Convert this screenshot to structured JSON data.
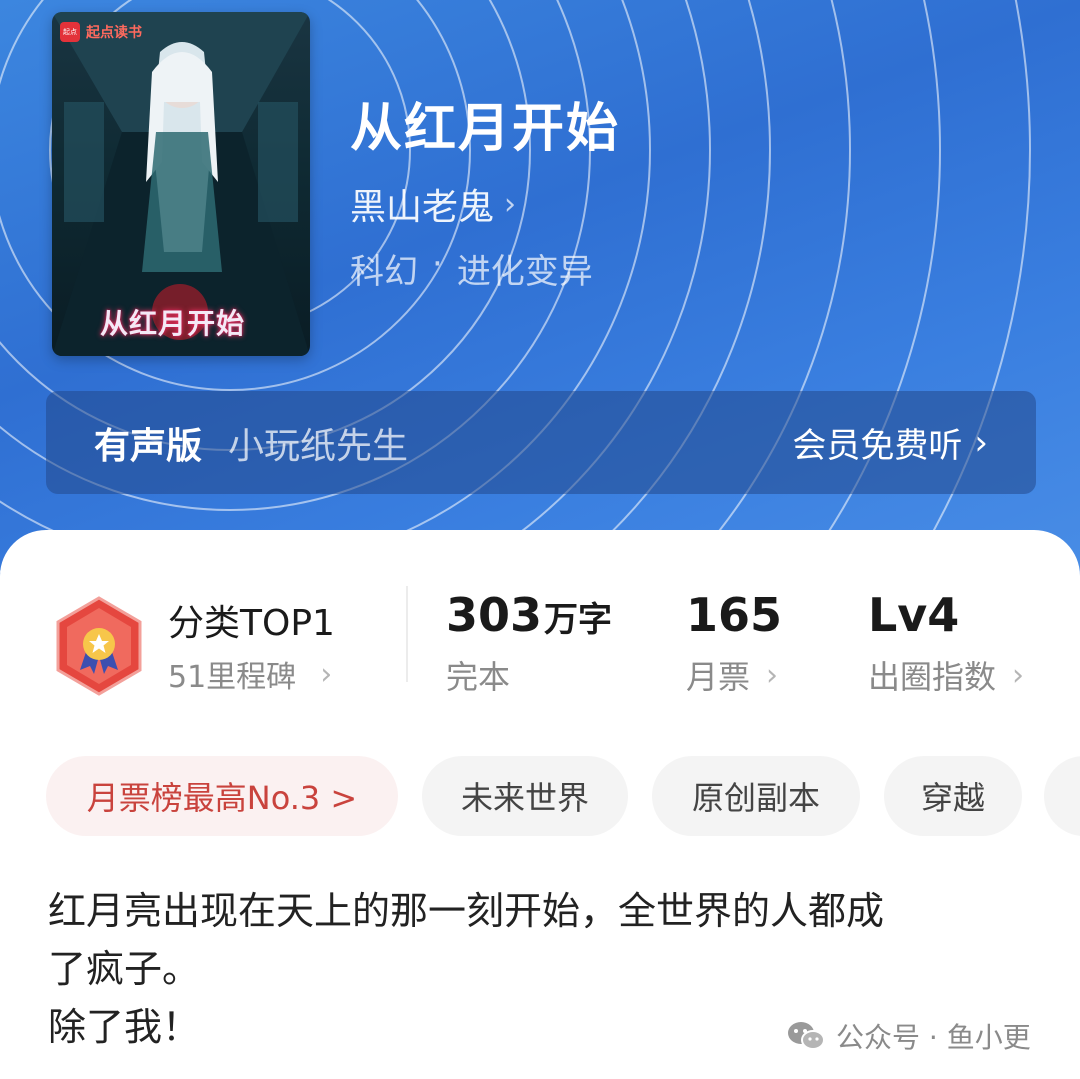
{
  "cover": {
    "brand_badge": "起点",
    "brand": "起点读书",
    "title_art": "从红月开始"
  },
  "book": {
    "title": "从红月开始",
    "author": "黑山老鬼",
    "category": "科幻",
    "separator": "·",
    "subcategory": "进化变异"
  },
  "audio": {
    "label": "有声版",
    "narrator": "小玩纸先生",
    "cta": "会员免费听"
  },
  "ranking": {
    "title": "分类TOP1",
    "milestones": "51里程碑"
  },
  "stats": [
    {
      "value": "303",
      "unit": "万字",
      "label": "完本"
    },
    {
      "value": "165",
      "unit": "",
      "label": "月票"
    },
    {
      "value": "Lv4",
      "unit": "",
      "label": "出圈指数"
    }
  ],
  "tags": [
    "月票榜最高No.3 >",
    "未来世界",
    "原创副本",
    "穿越"
  ],
  "intro": {
    "line1": "红月亮出现在天上的那一刻开始，全世界的人都成",
    "line2": "了疯子。",
    "line3": "除了我！"
  },
  "watermark": "公众号 · 鱼小更",
  "icons": {
    "chevron": "chevron-right-icon",
    "medal": "medal-icon",
    "wechat": "wechat-icon"
  },
  "colors": {
    "hero_blue": "#3378da",
    "hot_tag_text": "#c9433d",
    "medal_red": "#e5473f"
  }
}
